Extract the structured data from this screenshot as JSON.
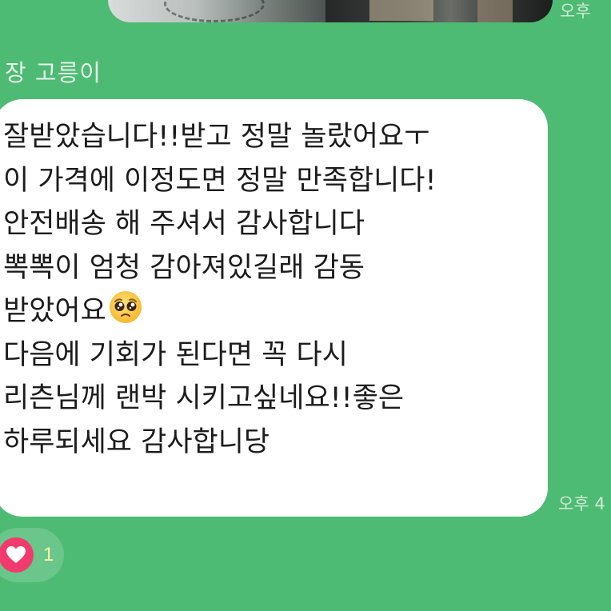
{
  "previous_message": {
    "time": "오후"
  },
  "sender": {
    "name": "장 고릉이"
  },
  "message": {
    "lines": [
      "잘받았습니다!!받고 정말 놀랐어요ㅜ",
      "이 가격에 이정도면 정말 만족합니다!",
      "안전배송 해 주셔서 감사합니다",
      "뽁뽁이 엄청 감아져있길래 감동",
      "받았어요",
      "다음에 기회가 된다면 꼭 다시",
      "리츤님께 랜박 시키고싶네요!!좋은",
      "하루되세요 감사합니당"
    ],
    "emoji": "pleading-face-icon",
    "time": "오후 4"
  },
  "reaction": {
    "icon": "heart-icon",
    "count": "1"
  },
  "colors": {
    "background": "#4dbb73",
    "bubble": "#ffffff",
    "heart": "#f23b6d",
    "reaction_count": "#fff7a8"
  }
}
